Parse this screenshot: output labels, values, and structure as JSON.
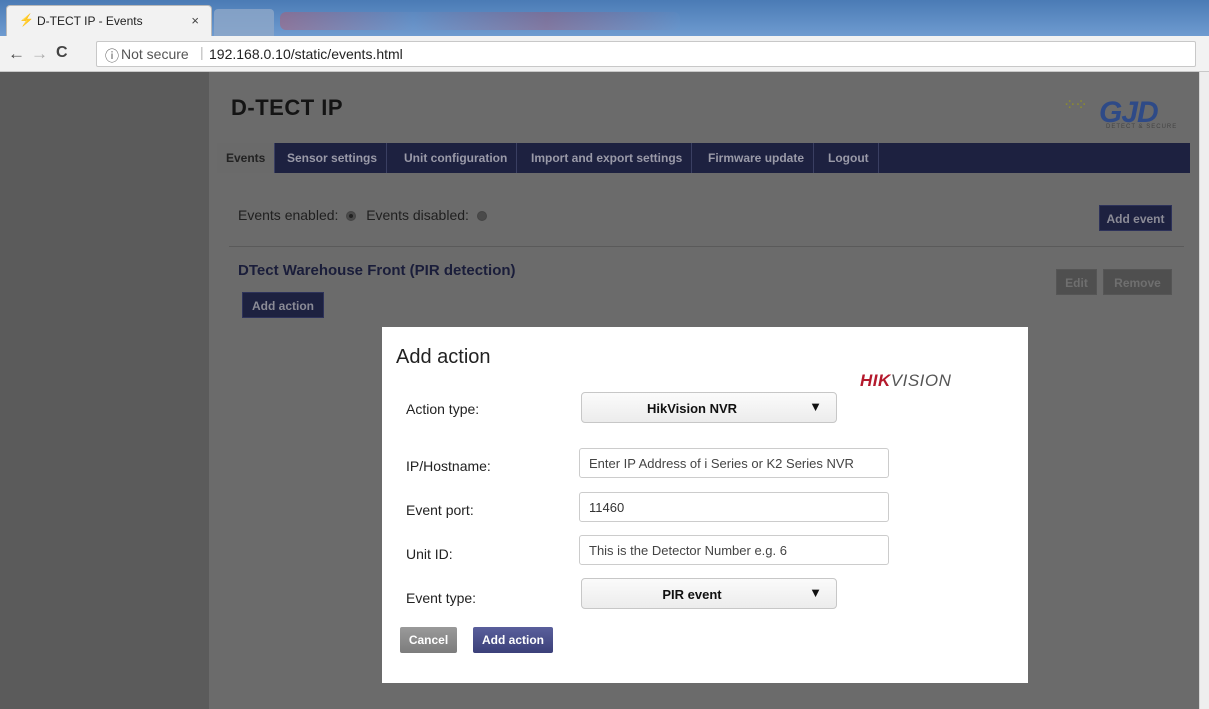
{
  "browser": {
    "tab_title": "D-TECT IP - Events",
    "tab_close": "×",
    "back": "←",
    "forward": "→",
    "reload": "C",
    "security_icon": "ⓘ",
    "security_text": "Not secure",
    "separator": "|",
    "url": "192.168.0.10/static/events.html"
  },
  "header": {
    "brand": "D-TECT IP",
    "logo_text": "GJD",
    "logo_subtext": "DETECT & SECURE"
  },
  "menu": [
    {
      "label": "Events",
      "active": true
    },
    {
      "label": "Sensor settings"
    },
    {
      "label": "Unit configuration"
    },
    {
      "label": "Import and export settings"
    },
    {
      "label": "Firmware update"
    },
    {
      "label": "Logout"
    }
  ],
  "events": {
    "enabled_label": "Events enabled:",
    "disabled_label": "Events disabled:",
    "add_event": "Add event",
    "event_name": "DTect Warehouse Front (PIR detection)",
    "edit": "Edit",
    "remove": "Remove",
    "add_action": "Add action"
  },
  "modal": {
    "title": "Add action",
    "brand_logo": "HIKVISION",
    "action_type_label": "Action type:",
    "action_type_value": "HikVision NVR",
    "ip_label": "IP/Hostname:",
    "ip_placeholder": "Enter IP Address of i Series or K2 Series NVR",
    "port_label": "Event port:",
    "port_value": "11460",
    "unit_label": "Unit ID:",
    "unit_placeholder": "This is the Detector Number e.g. 6",
    "event_type_label": "Event type:",
    "event_type_value": "PIR event",
    "cancel": "Cancel",
    "add_action": "Add action"
  },
  "colors": {
    "menu_bg": "#1d2140",
    "overlay": "#6b6b6b",
    "hikvision_red": "#b4192c",
    "primary_button": "#3b4079"
  }
}
